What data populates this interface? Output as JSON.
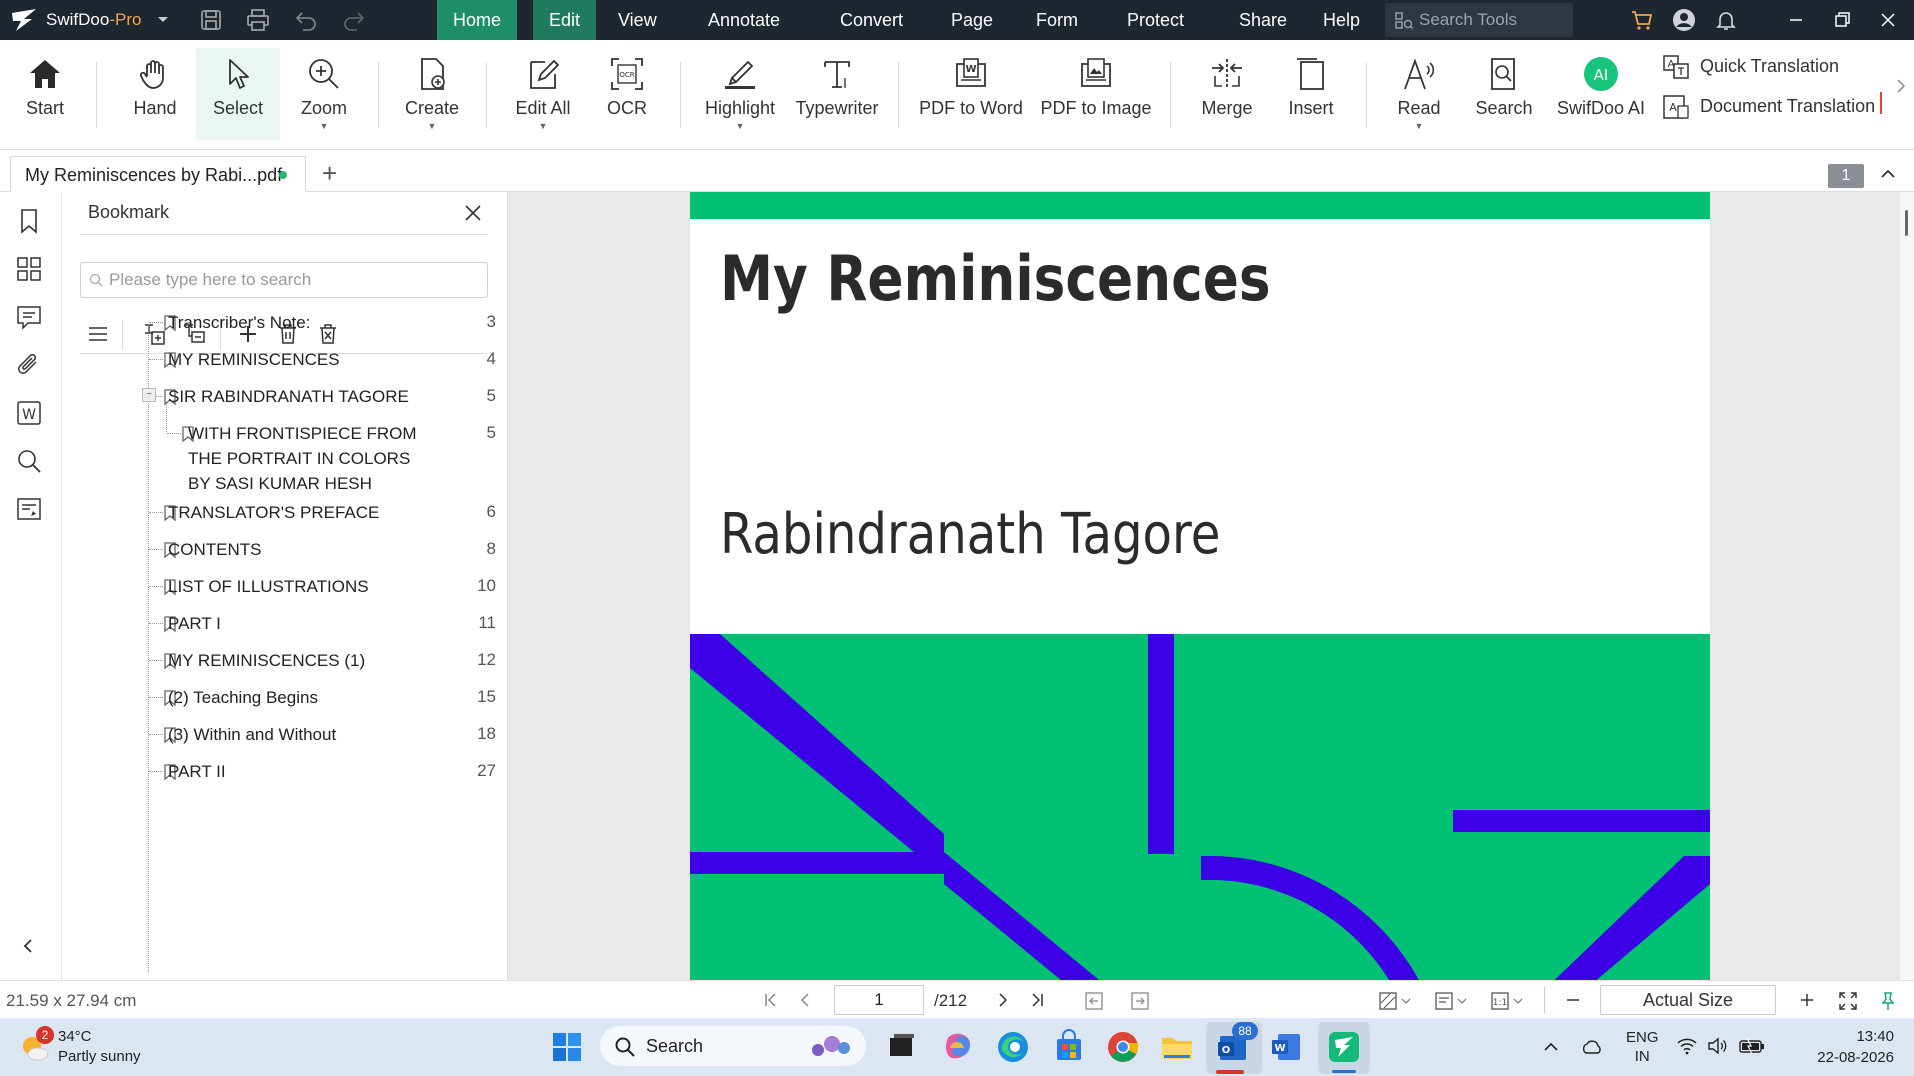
{
  "app": {
    "name": "SwifDoo",
    "edition": "-Pro"
  },
  "menu": [
    "Home",
    "Edit",
    "View",
    "Annotate",
    "Convert",
    "Page",
    "Form",
    "Protect",
    "Share",
    "Help"
  ],
  "search_tools": {
    "placeholder": "Search Tools"
  },
  "ribbon": {
    "start": "Start",
    "hand": "Hand",
    "select": "Select",
    "zoom": "Zoom",
    "create": "Create",
    "edit_all": "Edit All",
    "ocr": "OCR",
    "highlight": "Highlight",
    "typewriter": "Typewriter",
    "pdf_to_word": "PDF to Word",
    "pdf_to_image": "PDF to Image",
    "merge": "Merge",
    "insert": "Insert",
    "read": "Read",
    "search": "Search",
    "swifdoo_ai": "SwifDoo AI",
    "ai_badge": "AI",
    "quick_translation": "Quick Translation",
    "document_translation": "Document Translation"
  },
  "tab": {
    "name": "My Reminiscences by Rabi...pdf",
    "page_badge": "1"
  },
  "bookmark_panel": {
    "title": "Bookmark",
    "search_placeholder": "Please type here to search",
    "items": [
      {
        "label": "Transcriber's Note:",
        "page": "3"
      },
      {
        "label": "MY REMINISCENCES",
        "page": "4"
      },
      {
        "label": "SIR RABINDRANATH TAGORE",
        "page": "5"
      },
      {
        "label": "WITH FRONTISPIECE FROM THE PORTRAIT IN COLORS BY SASI KUMAR HESH",
        "page": "5"
      },
      {
        "label": "TRANSLATOR'S PREFACE",
        "page": "6"
      },
      {
        "label": "CONTENTS",
        "page": "8"
      },
      {
        "label": "LIST OF ILLUSTRATIONS",
        "page": "10"
      },
      {
        "label": "PART I",
        "page": "11"
      },
      {
        "label": "MY REMINISCENCES (1)",
        "page": "12"
      },
      {
        "label": "(2) Teaching Begins",
        "page": "15"
      },
      {
        "label": "(3) Within and Without",
        "page": "18"
      },
      {
        "label": "PART II",
        "page": "27"
      }
    ]
  },
  "document": {
    "title": "My Reminiscences",
    "author": "Rabindranath Tagore",
    "accent": "#00c073",
    "stripe": "#3c00e6"
  },
  "status": {
    "page_size": "21.59 x 27.94 cm",
    "current_page": "1",
    "total_pages": "/212",
    "zoom": "Actual Size"
  },
  "taskbar": {
    "weather_temp": "34°C",
    "weather_desc": "Partly sunny",
    "weather_badge": "2",
    "search": "Search",
    "mail_badge": "88",
    "lang1": "ENG",
    "lang2": "IN",
    "time": "13:40",
    "date": "22-08-2026"
  }
}
